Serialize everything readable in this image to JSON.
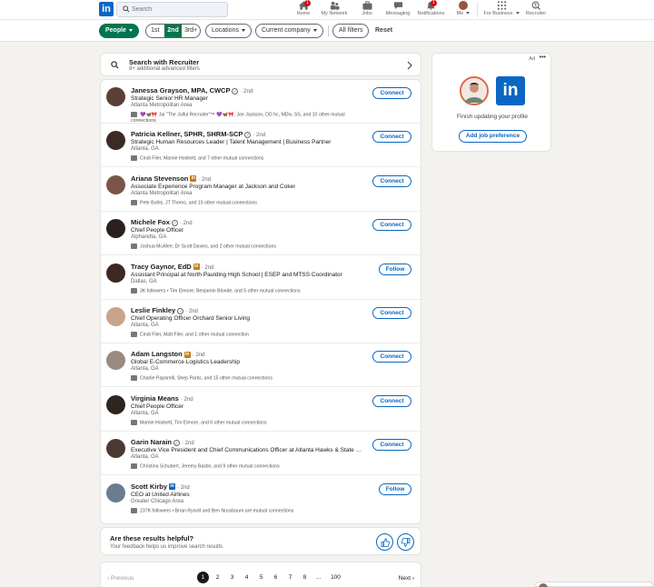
{
  "nav": {
    "search_placeholder": "Search",
    "items": [
      {
        "label": "Home",
        "icon": "home-icon",
        "badge": "1"
      },
      {
        "label": "My Network",
        "icon": "network-icon"
      },
      {
        "label": "Jobs",
        "icon": "jobs-icon"
      },
      {
        "label": "Messaging",
        "icon": "messaging-icon"
      },
      {
        "label": "Notifications",
        "icon": "bell-icon",
        "badge": "1"
      },
      {
        "label": "Me",
        "icon": "avatar"
      },
      {
        "label": "For Business",
        "icon": "grid-icon"
      },
      {
        "label": "Recruiter",
        "icon": "recruiter-icon"
      }
    ]
  },
  "filters": {
    "people": "People",
    "degrees": [
      "1st",
      "2nd",
      "3rd+"
    ],
    "locations": "Locations",
    "current_company": "Current company",
    "all_filters": "All filters",
    "reset": "Reset"
  },
  "recruiter": {
    "title": "Search with Recruiter",
    "subtitle": "8+ additional advanced filters"
  },
  "results": [
    {
      "name": "Janessa Grayson, MPA, CWCP",
      "badge": "verified",
      "degree": "· 2nd",
      "headline": "Strategic Senior HR Manager",
      "location": "Atlanta Metropolitan Area",
      "mutual": "💜🦋🎀 Jai \"The Joiful Recruiter\"™ 💜🦋🎀, Joe Jackson, DD hc, MDiv, SS, and 10 other mutual connections",
      "action": "Connect",
      "avatar_color": "#5a4036"
    },
    {
      "name": "Patricia Kellner, SPHR, SHRM-SCP",
      "badge": "verified",
      "degree": "· 2nd",
      "headline": "Strategic Human Resources Leader | Talent Management | Business Partner",
      "location": "Atlanta, GA",
      "mutual": "Cindi Filer, Mamie Hodnett, and 7 other mutual connections",
      "action": "Connect",
      "avatar_color": "#3b2a25"
    },
    {
      "name": "Ariana Stevenson",
      "badge": "premium",
      "degree": "· 2nd",
      "headline": "Associate Experience Program Manager at Jackson and Coker",
      "location": "Atlanta Metropolitan Area",
      "mutual": "Pete Buhls, JT Thoms, and 15 other mutual connections",
      "action": "Connect",
      "avatar_color": "#7a5648"
    },
    {
      "name": "Michele Fox",
      "badge": "verified",
      "degree": "· 2nd",
      "headline": "Chief People Officer",
      "location": "Alpharetta, GA",
      "mutual": "Joshua McAfee, Dr Scott Davies, and 2 other mutual connections",
      "action": "Connect",
      "avatar_color": "#2a211e"
    },
    {
      "name": "Tracy Gaynor, EdD",
      "badge": "premium",
      "degree": "· 2nd",
      "headline": "Assistant Principal at North Paulding High School | ESEP and MTSS Coordinator",
      "location": "Dallas, GA",
      "mutual": "3K followers • Tim Elmore, Benjamin Blonde, and 5 other mutual connections",
      "action": "Follow",
      "avatar_color": "#3d2822"
    },
    {
      "name": "Leslie Finkley",
      "badge": "verified",
      "degree": "· 2nd",
      "headline": "Chief Operating Officer Orchard Senior Living",
      "location": "Atlanta, GA",
      "mutual": "Cindi Filer, Matt Filer, and 1 other mutual connection",
      "action": "Connect",
      "avatar_color": "#c9a48a"
    },
    {
      "name": "Adam Langston",
      "badge": "premium",
      "degree": "· 2nd",
      "headline": "Global E-Commerce Logistics Leadership",
      "location": "Atlanta, GA",
      "mutual": "Charlie Paparelli, Shep Parks, and 15 other mutual connections",
      "action": "Connect",
      "avatar_color": "#9a8a80"
    },
    {
      "name": "Virginia Means",
      "badge": "none",
      "degree": "· 2nd",
      "headline": "Chief People Officer",
      "location": "Atlanta, GA",
      "mutual": "Mamie Hodnett, Tim Elmore, and 6 other mutual connections",
      "action": "Connect",
      "avatar_color": "#2e2420"
    },
    {
      "name": "Garin Narain",
      "badge": "verified",
      "degree": "· 2nd",
      "headline": "Executive Vice President and Chief Communications Officer at Atlanta Hawks & State Far...",
      "location": "Atlanta, GA",
      "mutual": "Christina Schubert, Jeremy Bastin, and 9 other mutual connections",
      "action": "Connect",
      "avatar_color": "#4a3a32"
    },
    {
      "name": "Scott Kirby",
      "badge": "linkedin",
      "degree": "· 2nd",
      "headline": "CEO at United Airlines",
      "location": "Greater Chicago Area",
      "mutual": "237K followers • Brian Rynott and Ben Nussbaum are mutual connections",
      "action": "Follow",
      "avatar_color": "#6b7c8f"
    }
  ],
  "feedback": {
    "question": "Are these results helpful?",
    "subtitle": "Your feedback helps us improve search results"
  },
  "pagination": {
    "prev": "Previous",
    "next": "Next",
    "pages": [
      "1",
      "2",
      "3",
      "4",
      "5",
      "6",
      "7",
      "8",
      "...",
      "100"
    ],
    "current": "1"
  },
  "ad": {
    "label": "Ad",
    "menu": "•••",
    "logo": "in",
    "text": "Finish updating your profile",
    "button": "Add job preference"
  },
  "colors": {
    "brand": "#0a66c2",
    "active_filter": "#01754f"
  }
}
